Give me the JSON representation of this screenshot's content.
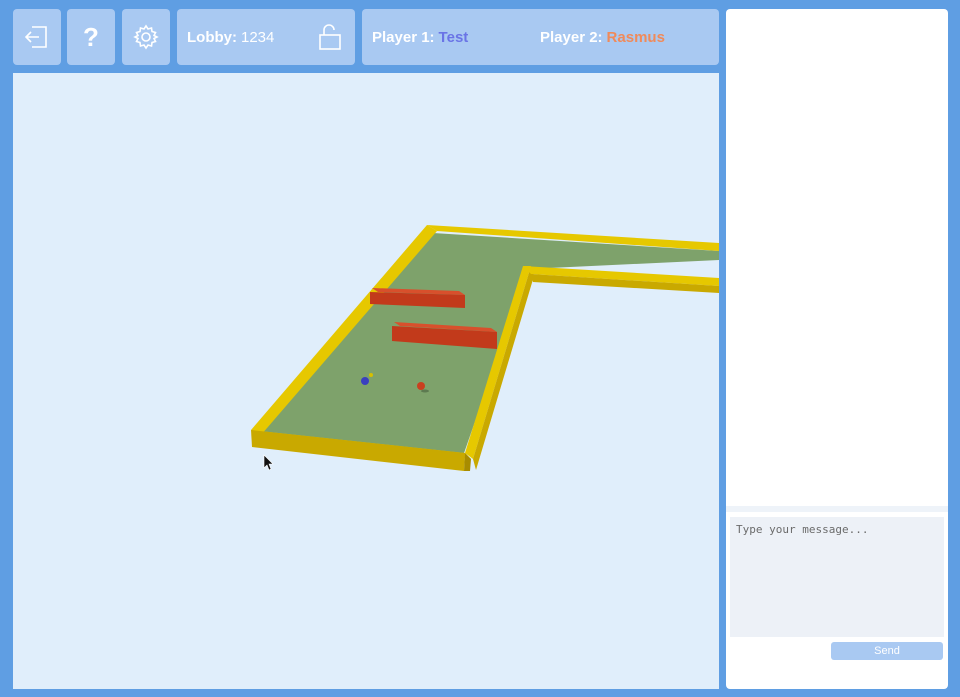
{
  "toolbar": {
    "exit_icon": "exit-icon",
    "help_label": "?",
    "settings_icon": "gear-icon"
  },
  "lobby": {
    "label": "Lobby:",
    "code": "1234",
    "lock_icon": "unlocked-padlock-icon"
  },
  "players": {
    "p1_label": "Player 1:",
    "p1_name": "Test",
    "p2_label": "Player 2:",
    "p2_name": "Rasmus"
  },
  "chat": {
    "placeholder": "Type your message...",
    "send_label": "Send"
  },
  "colors": {
    "background": "#5f9ee3",
    "panel": "#a9c9f2",
    "player1": "#6a74e6",
    "player2": "#f08a5a",
    "course_green": "#7ea26b",
    "wall_yellow": "#e0c000",
    "obstacle_red": "#c9401f"
  }
}
